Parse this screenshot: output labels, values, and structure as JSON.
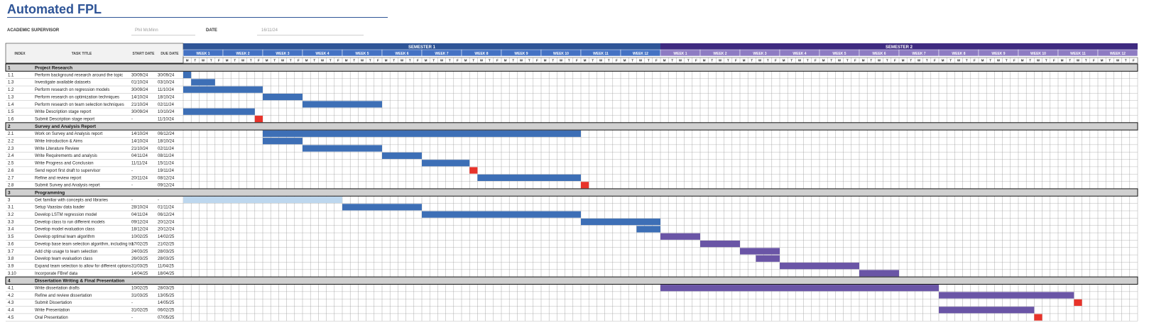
{
  "title": "Automated FPL",
  "supervisor": {
    "label": "ACADEMIC SUPERVISOR",
    "value": "Phil McMinn"
  },
  "date": {
    "label": "DATE",
    "value": "16/11/24"
  },
  "headers": {
    "index": "INDEX",
    "task": "TASK TITLE",
    "start": "START DATE",
    "due": "DUE DATE"
  },
  "semesters": [
    {
      "label": "SEMESTER 1",
      "weeks": [
        "WEEK 1",
        "WEEK 2",
        "WEEK 3",
        "WEEK 4",
        "WEEK 5",
        "WEEK 6",
        "WEEK 7",
        "WEEK 8",
        "WEEK 9",
        "WEEK 10",
        "WEEK 11",
        "WEEK 12"
      ]
    },
    {
      "label": "SEMESTER 2",
      "weeks": [
        "WEEK 1",
        "WEEK 2",
        "WEEK 3",
        "WEEK 4",
        "WEEK 5",
        "WEEK 6",
        "WEEK 7",
        "WEEK 8",
        "WEEK 9",
        "WEEK 10",
        "WEEK 11",
        "WEEK 12"
      ]
    }
  ],
  "day_letters": [
    "M",
    "T",
    "W",
    "T",
    "F"
  ],
  "colors": {
    "sem1": "#2f5597",
    "sem2": "#3e2a80",
    "week1": "#4472c4",
    "week2": "#8e7cc3",
    "bar_blue": "#3d6fb6",
    "bar_light": "#bdd7ee",
    "bar_purple": "#6a55a6",
    "milestone": "#e8332a",
    "group_bg": "#d0d0d0"
  },
  "rows": [
    {
      "type": "group",
      "index": "1",
      "task": "Project Research"
    },
    {
      "index": "1.1",
      "task": "Perform background research around the topic",
      "start": "30/09/24",
      "due": "30/09/24",
      "bar": {
        "s": 0,
        "e": 1,
        "c": "bar_blue"
      }
    },
    {
      "index": "1.3",
      "task": "Investigate available datasets",
      "start": "01/10/24",
      "due": "03/10/24",
      "bar": {
        "s": 1,
        "e": 4,
        "c": "bar_blue"
      }
    },
    {
      "index": "1.2",
      "task": "Perform research on regression models",
      "start": "30/09/24",
      "due": "11/10/24",
      "bar": {
        "s": 0,
        "e": 10,
        "c": "bar_blue"
      }
    },
    {
      "index": "1.3",
      "task": "Perform research on optimization techniques",
      "start": "14/10/24",
      "due": "18/10/24",
      "bar": {
        "s": 10,
        "e": 15,
        "c": "bar_blue"
      }
    },
    {
      "index": "1.4",
      "task": "Perform research on team selection techniques",
      "start": "21/10/24",
      "due": "02/11/24",
      "bar": {
        "s": 15,
        "e": 25,
        "c": "bar_blue"
      }
    },
    {
      "index": "1.5",
      "task": "Write Description stage report",
      "start": "30/09/24",
      "due": "10/10/24",
      "bar": {
        "s": 0,
        "e": 9,
        "c": "bar_blue"
      }
    },
    {
      "index": "1.6",
      "task": "Submit Description stage report",
      "start": "-",
      "due": "11/10/24",
      "bar": {
        "s": 9,
        "e": 10,
        "c": "milestone"
      }
    },
    {
      "type": "group",
      "index": "2",
      "task": "Survey and Analysis Report"
    },
    {
      "index": "2.1",
      "task": "Work on Survey and Analysis report",
      "start": "14/10/24",
      "due": "06/12/24",
      "bar": {
        "s": 10,
        "e": 50,
        "c": "bar_blue"
      }
    },
    {
      "index": "2.2",
      "task": "Write Introduction & Aims",
      "start": "14/10/24",
      "due": "18/10/24",
      "bar": {
        "s": 10,
        "e": 15,
        "c": "bar_blue"
      }
    },
    {
      "index": "2.3",
      "task": "Write Literature Review",
      "start": "21/10/24",
      "due": "02/11/24",
      "bar": {
        "s": 15,
        "e": 25,
        "c": "bar_blue"
      }
    },
    {
      "index": "2.4",
      "task": "Write Requirements and analysis",
      "start": "04/11/24",
      "due": "08/11/24",
      "bar": {
        "s": 25,
        "e": 30,
        "c": "bar_blue"
      }
    },
    {
      "index": "2.5",
      "task": "Write Progress and Conclusion",
      "start": "11/11/24",
      "due": "15/11/24",
      "bar": {
        "s": 30,
        "e": 36,
        "c": "bar_blue"
      }
    },
    {
      "index": "2.6",
      "task": "Send report first draft to supervisor",
      "start": "-",
      "due": "19/11/24",
      "bar": {
        "s": 36,
        "e": 37,
        "c": "milestone"
      }
    },
    {
      "index": "2.7",
      "task": "Refine and review report",
      "start": "20/11/24",
      "due": "08/12/24",
      "bar": {
        "s": 37,
        "e": 50,
        "c": "bar_blue"
      }
    },
    {
      "index": "2.8",
      "task": "Submit Survey and Analysis report",
      "start": "-",
      "due": "09/12/24",
      "bar": {
        "s": 50,
        "e": 51,
        "c": "milestone"
      }
    },
    {
      "type": "group",
      "index": "3",
      "task": "Programming"
    },
    {
      "index": "3",
      "task": "Get familiar with concepts and libraries",
      "start": "-",
      "due": "-",
      "bar": {
        "s": 0,
        "e": 20,
        "c": "bar_light"
      }
    },
    {
      "index": "3.1",
      "task": "Setup Vaastav data loader",
      "start": "28/10/24",
      "due": "01/11/24",
      "bar": {
        "s": 20,
        "e": 30,
        "c": "bar_blue"
      }
    },
    {
      "index": "3.2",
      "task": "Develop LSTM regression model",
      "start": "04/11/24",
      "due": "06/12/24",
      "bar": {
        "s": 30,
        "e": 50,
        "c": "bar_blue"
      }
    },
    {
      "index": "3.3",
      "task": "Develop class to run different models",
      "start": "09/12/24",
      "due": "20/12/24",
      "bar": {
        "s": 50,
        "e": 60,
        "c": "bar_blue"
      }
    },
    {
      "index": "3.4",
      "task": "Develop model evaluation class",
      "start": "18/12/24",
      "due": "20/12/24",
      "bar": {
        "s": 57,
        "e": 60,
        "c": "bar_blue"
      }
    },
    {
      "index": "3.5",
      "task": "Develop optimal team algorithm",
      "start": "10/02/25",
      "due": "14/02/25",
      "bar": {
        "s": 60,
        "e": 65,
        "c": "bar_purple"
      }
    },
    {
      "index": "3.6",
      "task": "Develop base team selection algorithm, including tra",
      "start": "17/02/25",
      "due": "21/02/25",
      "bar": {
        "s": 65,
        "e": 70,
        "c": "bar_purple"
      }
    },
    {
      "index": "3.7",
      "task": "Add chip usage to team selection",
      "start": "24/03/25",
      "due": "28/03/25",
      "bar": {
        "s": 70,
        "e": 75,
        "c": "bar_purple"
      }
    },
    {
      "index": "3.8",
      "task": "Develop team evaluation class",
      "start": "26/03/25",
      "due": "28/03/25",
      "bar": {
        "s": 72,
        "e": 75,
        "c": "bar_purple"
      }
    },
    {
      "index": "3.9",
      "task": "Expand team selection to allow for different options",
      "start": "31/03/25",
      "due": "11/04/25",
      "bar": {
        "s": 75,
        "e": 85,
        "c": "bar_purple"
      }
    },
    {
      "index": "3.10",
      "task": "Incorporate FBref data",
      "start": "14/04/25",
      "due": "18/04/25",
      "bar": {
        "s": 85,
        "e": 90,
        "c": "bar_purple"
      }
    },
    {
      "type": "group",
      "index": "4",
      "task": "Dissertation Writing & Final Presentation"
    },
    {
      "index": "4.1",
      "task": "Write dissertation drafts",
      "start": "10/02/25",
      "due": "28/03/25",
      "bar": {
        "s": 60,
        "e": 95,
        "c": "bar_purple"
      }
    },
    {
      "index": "4.2",
      "task": "Refine and review dissertation",
      "start": "31/03/25",
      "due": "13/05/25",
      "bar": {
        "s": 95,
        "e": 112,
        "c": "bar_purple"
      }
    },
    {
      "index": "4.3",
      "task": "Submit Dissertation",
      "start": "-",
      "due": "14/05/25",
      "bar": {
        "s": 112,
        "e": 113,
        "c": "milestone"
      }
    },
    {
      "index": "4.4",
      "task": "Write Presentation",
      "start": "31/02/25",
      "due": "06/02/25",
      "bar": {
        "s": 95,
        "e": 107,
        "c": "bar_purple"
      }
    },
    {
      "index": "4.5",
      "task": "Oral Presentation",
      "start": "-",
      "due": "07/05/25",
      "bar": {
        "s": 107,
        "e": 108,
        "c": "milestone"
      }
    }
  ]
}
